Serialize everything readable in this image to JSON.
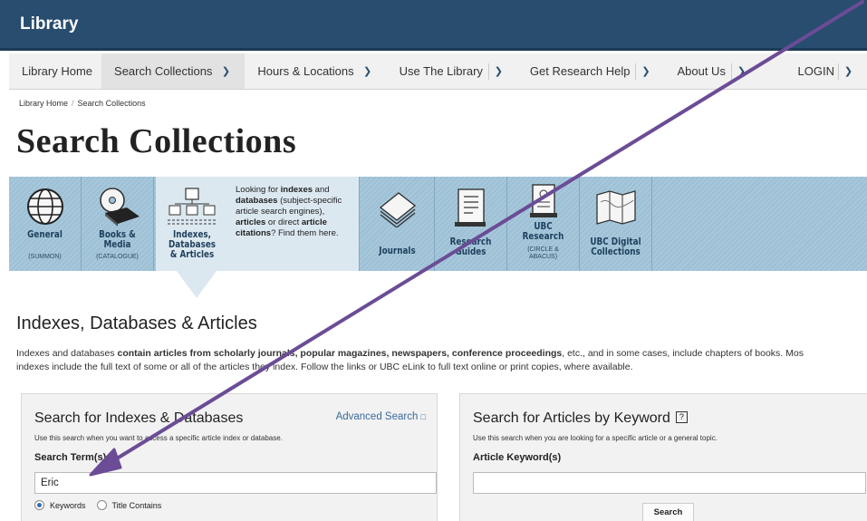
{
  "brand": "Library",
  "nav": {
    "items": [
      {
        "label": "Library Home"
      },
      {
        "label": "Search Collections"
      },
      {
        "label": "Hours & Locations"
      },
      {
        "label": "Use The Library"
      },
      {
        "label": "Get Research Help"
      },
      {
        "label": "About Us"
      }
    ],
    "login": "LOGIN"
  },
  "breadcrumb": {
    "home": "Library Home",
    "sep": "/",
    "current": "Search Collections"
  },
  "page_title": "Search Collections",
  "categories": {
    "general": {
      "title1": "General",
      "sub": "(SUMMON)"
    },
    "books": {
      "title1": "Books &",
      "title2": "Media",
      "sub": "(CATALOGUE)"
    },
    "indexes": {
      "title1": "Indexes,",
      "title2": "Databases",
      "title3": "& Articles",
      "desc_1": "Looking for ",
      "desc_2": "indexes",
      "desc_3": " and ",
      "desc_4": "databases",
      "desc_5": " (subject-specific article search engines), ",
      "desc_6": "articles",
      "desc_7": " or direct ",
      "desc_8": "article citations",
      "desc_9": "? Find them here."
    },
    "journals": {
      "title1": "Journals"
    },
    "research": {
      "title1": "Research",
      "title2": "Guides"
    },
    "ubc": {
      "title1": "UBC",
      "title2": "Research",
      "sub1": "(CIRCLE &",
      "sub2": "ABACUS)"
    },
    "digital": {
      "title1": "UBC Digital",
      "title2": "Collections"
    }
  },
  "section": {
    "heading": "Indexes, Databases & Articles",
    "intro_1": "Indexes and databases ",
    "intro_2": "contain articles from scholarly journals, popular magazines, newspapers, conference proceedings",
    "intro_3": ", etc., and in some cases, include chapters of books. Mos",
    "intro_4": "indexes include the full text of some or all of the articles they index. Follow the links or UBC eLink to full text online or print copies, where available."
  },
  "panel_left": {
    "title": "Search for Indexes & Databases",
    "advanced": "Advanced Search",
    "hint": "Use this search when you want to access a specific article index or database.",
    "label": "Search Term(s)",
    "value": "Eric",
    "radio1": "Keywords",
    "radio2": "Title Contains"
  },
  "panel_right": {
    "title": "Search for Articles by Keyword",
    "help": "?",
    "hint": "Use this search when you are looking for a specific article or a general topic.",
    "label": "Article Keyword(s)",
    "value": "",
    "button": "Search"
  },
  "colors": {
    "header": "#284d6e",
    "categories": "#9ec1d6",
    "active_category": "#dce8f0",
    "annotation_arrow": "#6b4c96"
  },
  "annotation": {
    "arrow": "purple-arrow-icon"
  }
}
